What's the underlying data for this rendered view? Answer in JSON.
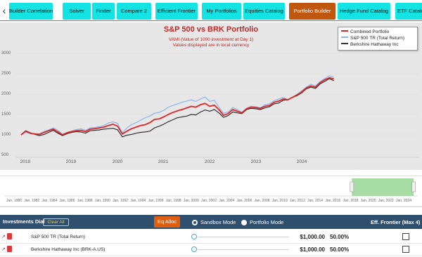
{
  "tabs": {
    "back_icon": "chevron-left-icon",
    "items": [
      {
        "label": "Builder Correlations"
      },
      {
        "label": "Solver"
      },
      {
        "label": "Finder"
      },
      {
        "label": "Compare 2"
      },
      {
        "label": "Efficient Frontier"
      },
      {
        "label": "My Portfolios"
      },
      {
        "label": "Equities Catalog"
      },
      {
        "label": "Portfolio Builder",
        "active": true
      },
      {
        "label": "Hedge Fund Catalog"
      },
      {
        "label": "ETF Catalog"
      }
    ]
  },
  "colors": {
    "accent_tab": "#13e3e3",
    "active_tab": "#c0570f",
    "combined": "#e02424",
    "sp500": "#8ab8ec",
    "brk": "#333333",
    "panel": "#2f4f6f",
    "navigator_fill": "#a7dca4"
  },
  "chart_data": {
    "type": "line",
    "title": "S&P 500 vs BRK Portfolio",
    "subtitle_1": "VAMI (Value of 1000 investment at Day 1)",
    "subtitle_2": "Values displayed are in local currency",
    "y_ticks": [
      "3000",
      "2500",
      "2000",
      "1500",
      "1000",
      "500"
    ],
    "ylim": [
      500,
      3000
    ],
    "x_ticks": [
      "2018",
      "2019",
      "2020",
      "2021",
      "2022",
      "2023",
      "2024"
    ],
    "xlim": [
      2018.0,
      2024.85
    ],
    "legend": [
      "Combined Portfolio",
      "S&P 500 TR (Total Return)",
      "Berkshire Hathaway Inc"
    ],
    "legend_position": "top-right",
    "x": [
      2018.0,
      2018.1,
      2018.2,
      2018.3,
      2018.4,
      2018.5,
      2018.6,
      2018.7,
      2018.8,
      2018.9,
      2019.0,
      2019.1,
      2019.2,
      2019.3,
      2019.4,
      2019.5,
      2019.6,
      2019.7,
      2019.8,
      2019.9,
      2020.0,
      2020.1,
      2020.2,
      2020.3,
      2020.4,
      2020.5,
      2020.6,
      2020.7,
      2020.8,
      2020.9,
      2021.0,
      2021.1,
      2021.2,
      2021.3,
      2021.4,
      2021.5,
      2021.6,
      2021.7,
      2021.8,
      2021.9,
      2022.0,
      2022.1,
      2022.2,
      2022.3,
      2022.4,
      2022.5,
      2022.6,
      2022.7,
      2022.8,
      2022.9,
      2023.0,
      2023.1,
      2023.2,
      2023.3,
      2023.4,
      2023.5,
      2023.6,
      2023.7,
      2023.8,
      2023.9,
      2024.0,
      2024.1,
      2024.2,
      2024.3,
      2024.4,
      2024.5,
      2024.6,
      2024.7,
      2024.8
    ],
    "series": [
      {
        "name": "Combined Portfolio",
        "values": [
          1000,
          1090,
          1040,
          1020,
          1010,
          1060,
          1100,
          1140,
          1070,
          1000,
          1050,
          1080,
          1100,
          1110,
          1080,
          1140,
          1150,
          1170,
          1190,
          1230,
          1260,
          1210,
          1020,
          1090,
          1150,
          1190,
          1230,
          1250,
          1300,
          1380,
          1390,
          1440,
          1500,
          1550,
          1590,
          1620,
          1660,
          1700,
          1680,
          1740,
          1770,
          1700,
          1730,
          1620,
          1480,
          1520,
          1620,
          1580,
          1540,
          1640,
          1680,
          1670,
          1650,
          1700,
          1720,
          1800,
          1830,
          1880,
          1860,
          1920,
          1980,
          2050,
          2150,
          2200,
          2170,
          2280,
          2350,
          2400,
          2370
        ]
      },
      {
        "name": "S&P 500 TR (Total Return)",
        "values": [
          1000,
          1060,
          1030,
          1020,
          1030,
          1080,
          1120,
          1170,
          1110,
          1010,
          1060,
          1090,
          1130,
          1150,
          1110,
          1170,
          1180,
          1200,
          1230,
          1290,
          1320,
          1280,
          1050,
          1170,
          1250,
          1300,
          1360,
          1420,
          1460,
          1530,
          1550,
          1600,
          1680,
          1720,
          1760,
          1800,
          1830,
          1860,
          1820,
          1880,
          1930,
          1820,
          1850,
          1680,
          1530,
          1560,
          1670,
          1620,
          1550,
          1650,
          1700,
          1690,
          1660,
          1740,
          1760,
          1840,
          1880,
          1920,
          1860,
          1920,
          2000,
          2080,
          2170,
          2240,
          2200,
          2310,
          2380,
          2450,
          2410
        ]
      },
      {
        "name": "Berkshire Hathaway Inc",
        "values": [
          1000,
          1100,
          1050,
          1010,
          980,
          1010,
          1060,
          1110,
          1040,
          980,
          1030,
          1060,
          1080,
          1070,
          1040,
          1100,
          1110,
          1120,
          1140,
          1150,
          1160,
          1120,
          950,
          990,
          1010,
          1040,
          1060,
          1070,
          1090,
          1170,
          1210,
          1260,
          1320,
          1370,
          1420,
          1440,
          1460,
          1500,
          1490,
          1560,
          1610,
          1580,
          1620,
          1540,
          1430,
          1470,
          1560,
          1540,
          1520,
          1620,
          1650,
          1640,
          1620,
          1660,
          1690,
          1760,
          1780,
          1850,
          1860,
          1920,
          1960,
          2030,
          2130,
          2170,
          2140,
          2250,
          2310,
          2380,
          2330
        ]
      }
    ]
  },
  "navigator": {
    "ticks": [
      "Jan, 1980",
      "Jan, 1982",
      "Jan, 1984",
      "Jan, 1986",
      "Jan, 1988",
      "Jan, 1990",
      "Jan, 1992",
      "Jan, 1994",
      "Jan, 1996",
      "Jan, 1998",
      "Jan, 2000",
      "Jan, 2002",
      "Jan, 2004",
      "Jan, 2006",
      "Jan, 2008",
      "Jan, 2010",
      "Jan, 2012",
      "Jan, 2014",
      "Jan, 2016",
      "Jan, 2018",
      "Jan, 2020",
      "Jan, 2022",
      "Jan, 2024"
    ],
    "range_start": 2018.0,
    "range_end": 2024.85,
    "axis_start": 1979.5,
    "axis_end": 2025.3
  },
  "investments": {
    "title": "Investments Dial",
    "clear_label": "Clear All",
    "eq_alloc_label": "Eq Alloc",
    "sandbox_label": "Sandbox Mode",
    "portfolio_label": "Portfolio Mode",
    "mode_selected": "Sandbox Mode",
    "frontier_label": "Eff. Frontier (Max 4)",
    "rows": [
      {
        "name": "S&P 500 TR (Total Return)",
        "amount": "$1,000.00",
        "pct": "50.00%"
      },
      {
        "name": "Berkshire Hathaway Inc (BRK-A.US)",
        "amount": "$1,000.00",
        "pct": "50.00%"
      }
    ]
  }
}
